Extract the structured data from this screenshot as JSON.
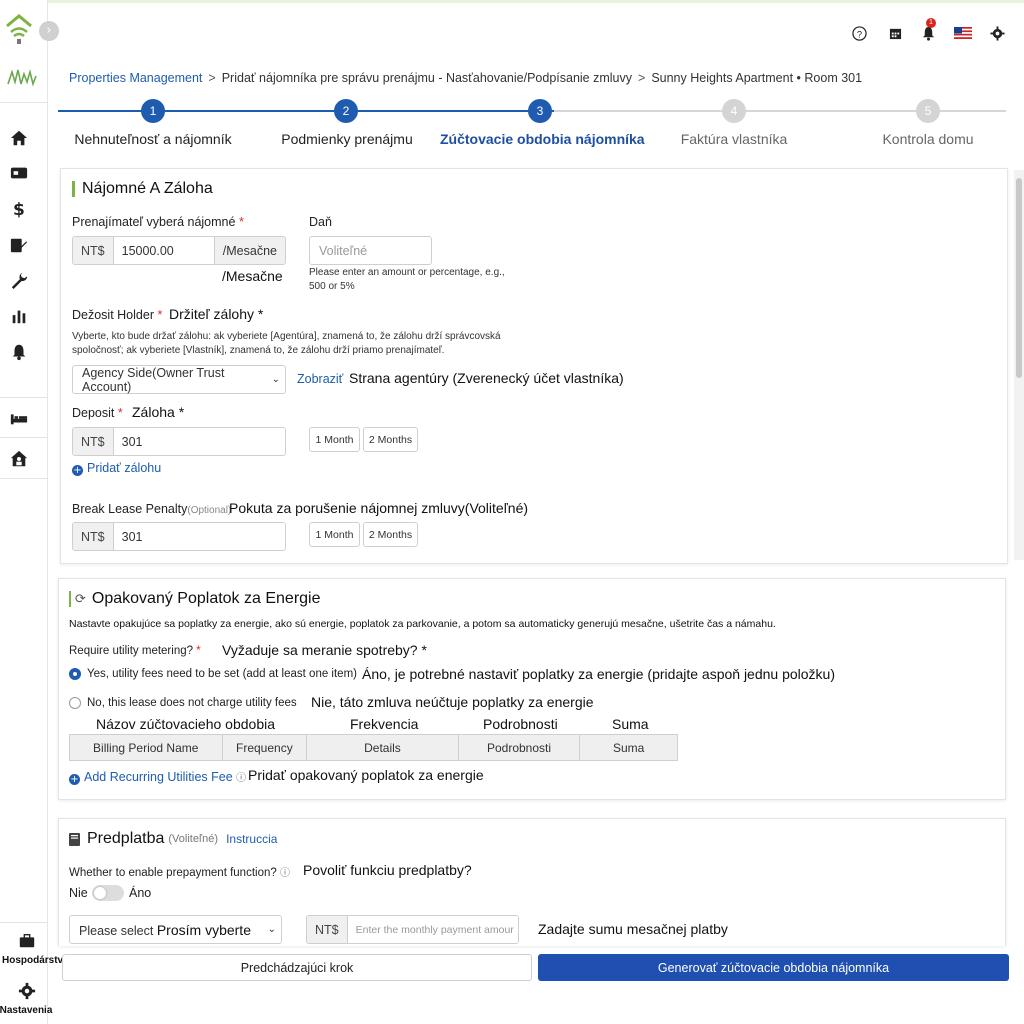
{
  "header": {
    "notification_count": "1"
  },
  "breadcrumb": {
    "root": "Properties Management",
    "step": "Pridať nájomníka pre správu prenájmu - Nasťahovanie/Podpísanie zmluvy",
    "property": "Sunny Heights Apartment • Room 301"
  },
  "stepper": [
    {
      "num": "1",
      "label": "Nehnuteľnosť a nájomník"
    },
    {
      "num": "2",
      "label": "Podmienky prenájmu"
    },
    {
      "num": "3",
      "label": "Zúčtovacie obdobia nájomníka"
    },
    {
      "num": "4",
      "label": "Faktúra vlastníka"
    },
    {
      "num": "5",
      "label": "Kontrola domu"
    }
  ],
  "rent": {
    "title": "Nájomné A Záloha",
    "rent_label": "Prenajímateľ vyberá nájomné",
    "req": "*",
    "currency": "NT$",
    "rent_value": "15000.00",
    "per_month": "/Mesačne",
    "per_month_sk": "/Mesačne",
    "tax_label": "Daň",
    "tax_placeholder": "Voliteľné",
    "tax_hint": "Please enter an amount or percentage, e.g., 500 or 5%",
    "holder_label": "Dežosit Holder",
    "holder_label_sk": "Držiteľ zálohy *",
    "holder_desc": "Vyberte, kto bude držať zálohu: ak vyberiete [Agentúra], znamená to, že zálohu drží správcovská spoločnosť; ak vyberiete [Vlastník], znamená to, že zálohu drží priamo prenajímateľ.",
    "holder_select": "Agency Side(Owner Trust Account)",
    "holder_show": "Zobraziť",
    "holder_sk": "Strana agentúry (Zverenecký účet vlastníka)",
    "deposit_label": "Deposit",
    "deposit_label_sk": "Záloha *",
    "deposit_value": "301",
    "chip_1": "1 Month",
    "chip_2": "2 Months",
    "add_deposit": "Pridať zálohu",
    "penalty_label": "Break Lease Penalty",
    "penalty_optional": "(Optional)",
    "penalty_sk": "Pokuta za porušenie nájomnej zmluvy(Voliteľné)",
    "penalty_value": "301"
  },
  "utility": {
    "title": "Opakovaný Poplatok za Energie",
    "desc": "Nastavte opakujúce sa poplatky za energie, ako sú energie, poplatok za parkovanie, a potom sa automaticky generujú mesačne, ušetrite čas a námahu.",
    "metering_label": "Require utility metering?",
    "metering_sk": "Vyžaduje sa meranie spotreby? *",
    "yes_label": "Yes, utility fees need to be set (add at least one item)",
    "yes_sk": "Áno, je potrebné nastaviť poplatky za energie (pridajte aspoň jednu položku)",
    "no_label": "No, this lease does not charge utility fees",
    "no_sk": "Nie, táto zmluva neúčtuje poplatky za energie",
    "col_sk": [
      "Názov zúčtovacieho obdobia",
      "Frekvencia",
      "Podrobnosti",
      "Suma"
    ],
    "columns": [
      "Billing Period Name",
      "Frequency",
      "Details",
      "Podrobnosti",
      "Suma"
    ],
    "add_fee": "Add Recurring Utilities Fee",
    "add_fee_sk": "Pridať opakovaný poplatok za energie"
  },
  "prepay": {
    "title": "Predplatba",
    "optional": "(Voliteľné)",
    "instructions": "Instruccia",
    "enable_label": "Whether to enable prepayment function?",
    "enable_sk": "Povoliť funkciu predplatby?",
    "toggle_off": "Nie",
    "toggle_on": "Áno",
    "select_placeholder": "Please select",
    "select_sk": "Prosím vyberte",
    "currency": "NT$",
    "amount_placeholder": "Enter the monthly payment amour",
    "amount_sk": "Zadajte sumu mesačnej platby"
  },
  "footer": {
    "prev": "Predchádzajúci krok",
    "generate": "Generovať zúčtovacie obdobia nájomníka"
  },
  "rail": {
    "hospodarstvo": "Hospodárstvo",
    "settings": "Nastavenia"
  },
  "colors": {
    "primary": "#1f4fb0",
    "accent_green": "#7cb342"
  }
}
